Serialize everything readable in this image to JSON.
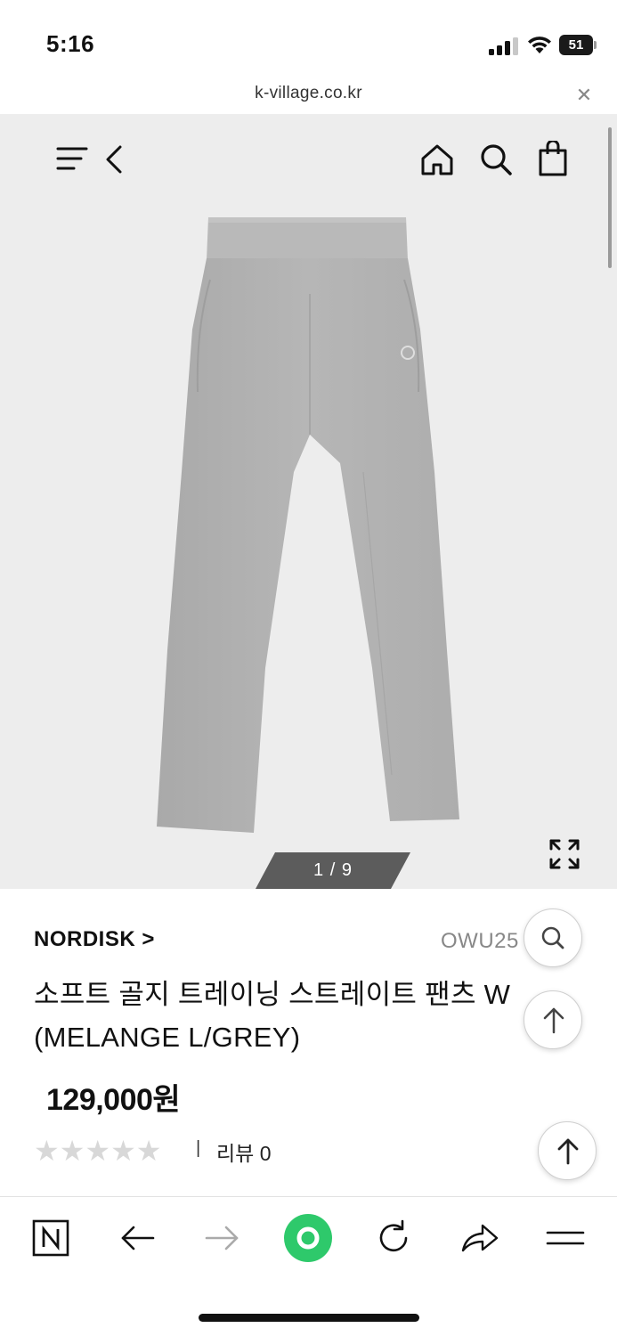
{
  "status_bar": {
    "time": "5:16",
    "battery": "51"
  },
  "browser": {
    "url": "k-village.co.kr"
  },
  "gallery": {
    "pager": "1 / 9"
  },
  "product": {
    "brand": "NORDISK >",
    "code": "OWU25",
    "title": "소프트 골지 트레이닝 스트레이트 팬츠 W (MELANGE L/GREY)",
    "price": "129,000원",
    "rating_stars": "★★★★★",
    "review_sep": "|",
    "review_label": "리뷰 0"
  },
  "colors": {
    "gallery_bg": "#ededed",
    "pants": "#b3b3b3",
    "pager_bg": "#5a5a5a",
    "naver_green": "#2ec96b"
  },
  "icons": {
    "top_nav": [
      "menu-icon",
      "back-icon",
      "home-icon",
      "search-icon",
      "shopping-bag-icon"
    ],
    "floating": [
      "search-icon",
      "arrow-up-icon",
      "arrow-up-icon"
    ],
    "bottom_bar": [
      "naver-n-icon",
      "back-arrow-icon",
      "forward-arrow-icon",
      "green-dot-icon",
      "reload-icon",
      "share-icon",
      "hamburger-icon"
    ]
  }
}
